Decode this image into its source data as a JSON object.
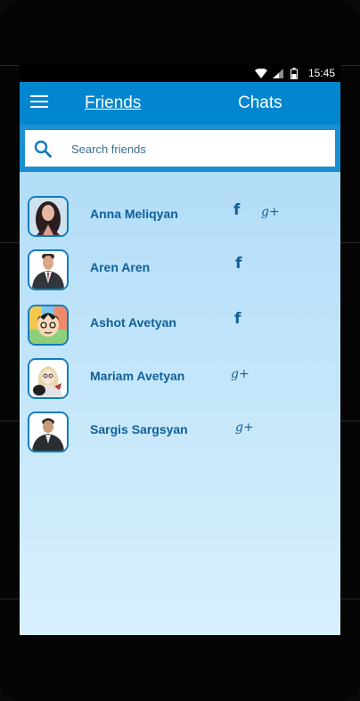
{
  "statusbar": {
    "time": "15:45"
  },
  "appbar": {
    "friends_tab": "Friends",
    "chats_tab": "Chats"
  },
  "search": {
    "placeholder": "Search friends"
  },
  "icons": {
    "facebook": "f",
    "google_plus": "g+"
  },
  "friends": [
    {
      "name": "Anna Meliqyan",
      "networks": [
        "facebook",
        "google-plus"
      ]
    },
    {
      "name": "Aren Aren",
      "networks": [
        "facebook"
      ]
    },
    {
      "name": "Ashot Avetyan",
      "networks": [
        "facebook"
      ]
    },
    {
      "name": "Mariam Avetyan",
      "networks": [
        "google-plus"
      ]
    },
    {
      "name": "Sargis Sargsyan",
      "networks": [
        "google-plus"
      ]
    }
  ],
  "colors": {
    "appbar": "#0386d0",
    "accent_text": "#10609a",
    "avatar_border": "#0e7cc0"
  }
}
